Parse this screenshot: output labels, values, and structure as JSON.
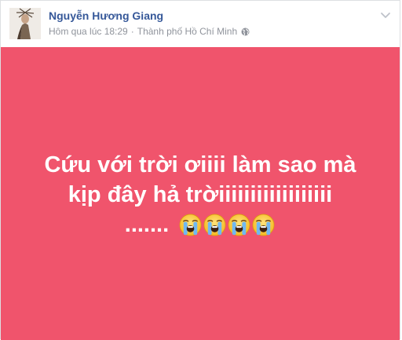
{
  "post": {
    "author": "Nguyễn Hương Giang",
    "timestamp": "Hôm qua lúc 18:29",
    "separator": "·",
    "location": "Thành phố Hồ Chí Minh",
    "privacy_icon": "globe-icon",
    "menu_icon": "chevron-down-icon",
    "status": {
      "line1": "Cứu với trời ơiiii làm sao mà",
      "line2": "kịp đây hả trờiiiiiiiiiiiiiiiiii",
      "line3": ".......",
      "emojis": [
        "crying-face-icon",
        "crying-face-icon",
        "crying-face-icon",
        "crying-face-icon"
      ],
      "background_color": "#f0546c",
      "text_color": "#ffffff"
    }
  },
  "colors": {
    "author_link": "#365899",
    "meta_text": "#90949c"
  }
}
